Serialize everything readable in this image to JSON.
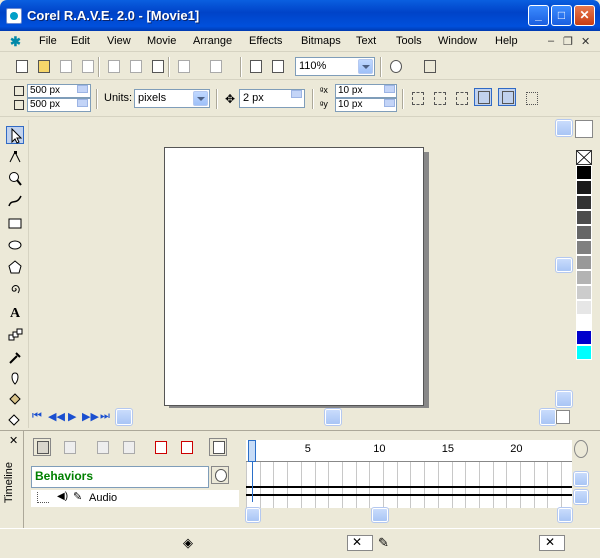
{
  "window": {
    "title": "Corel R.A.V.E. 2.0 - [Movie1]"
  },
  "menu": [
    "File",
    "Edit",
    "View",
    "Movie",
    "Arrange",
    "Effects",
    "Bitmaps",
    "Text",
    "Tools",
    "Window",
    "Help"
  ],
  "toolbar": {
    "zoom": "110%"
  },
  "property_bar": {
    "width": "500 px",
    "height": "500 px",
    "units_label": "Units:",
    "units_value": "pixels",
    "nudge": "2 px",
    "dup_x": "10 px",
    "dup_y": "10 px"
  },
  "palette": [
    "#000000",
    "#1a1a1a",
    "#333333",
    "#4d4d4d",
    "#666666",
    "#808080",
    "#999999",
    "#b3b3b3",
    "#cccccc",
    "#e6e6e6",
    "#ffffff",
    "#0000cc",
    "#00ffff"
  ],
  "timeline": {
    "panel_label": "Timeline",
    "behaviors_label": "Behaviors",
    "layer_name": "Audio",
    "ruler": [
      "1",
      "5",
      "10",
      "15",
      "20"
    ]
  }
}
